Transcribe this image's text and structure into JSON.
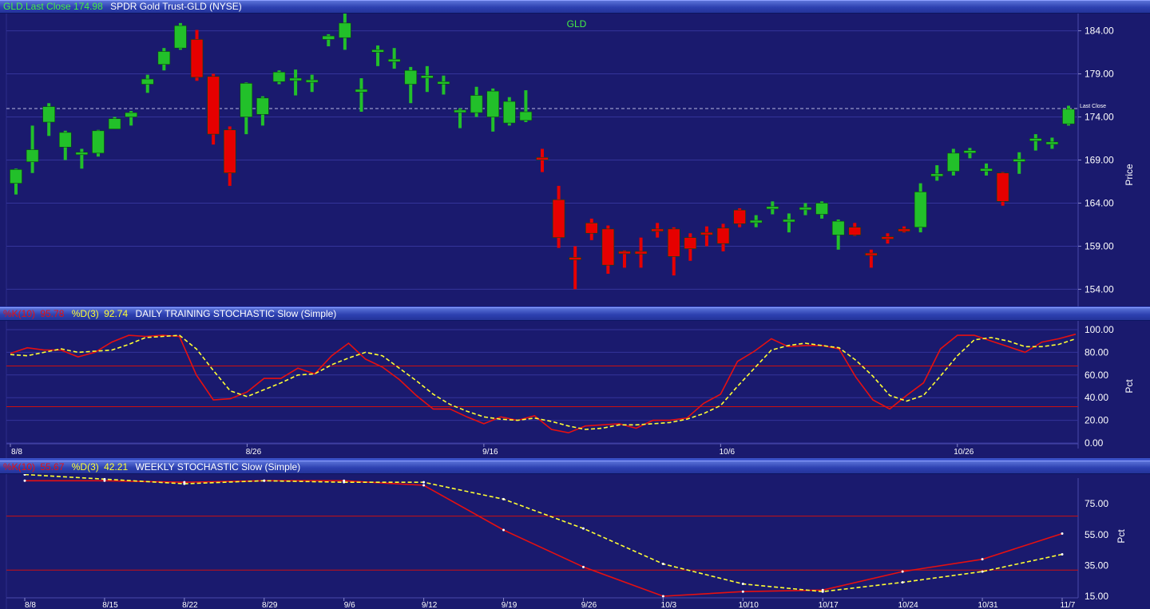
{
  "header": {
    "symbol_label": "GLD.Last Close",
    "last_close": "174.98",
    "description": "SPDR Gold Trust-GLD (NYSE)"
  },
  "daily_header": {
    "k_label": "%K(10)",
    "k_value": "95.78",
    "d_label": "%D(3)",
    "d_value": "92.74",
    "title": "DAILY TRAINING STOCHASTIC Slow (Simple)"
  },
  "weekly_header": {
    "k_label": "%K(10)",
    "k_value": "55.67",
    "d_label": "%D(3)",
    "d_value": "42.21",
    "title": "WEEKLY STOCHASTIC Slow (Simple)"
  },
  "colors": {
    "background": "#1a1a6e",
    "up": "#22c02a",
    "down": "#e60000",
    "k_line": "#e61010",
    "d_line": "#ffff33",
    "grid": "#34349a",
    "threshold": "#cc1010",
    "label_green": "#44ee44"
  },
  "chart_data": [
    {
      "type": "candlestick",
      "title": "GLD",
      "ylabel": "Price",
      "ylim": [
        152,
        186
      ],
      "yticks": [
        "184.00",
        "179.00",
        "174.00",
        "169.00",
        "164.00",
        "159.00",
        "154.00"
      ],
      "last_close_label": "Last Close",
      "last_close": 174.98,
      "candles": [
        {
          "o": 166.3,
          "c": 167.9,
          "h": 168.0,
          "l": 165.0
        },
        {
          "o": 168.8,
          "c": 170.2,
          "h": 173.0,
          "l": 167.5
        },
        {
          "o": 173.4,
          "c": 175.2,
          "h": 175.6,
          "l": 171.8
        },
        {
          "o": 170.5,
          "c": 172.2,
          "h": 172.4,
          "l": 169.0
        },
        {
          "o": 169.8,
          "c": 169.9,
          "h": 170.3,
          "l": 168.0
        },
        {
          "o": 169.8,
          "c": 172.4,
          "h": 172.5,
          "l": 169.4
        },
        {
          "o": 172.6,
          "c": 173.8,
          "h": 174.0,
          "l": 172.6
        },
        {
          "o": 174.0,
          "c": 174.5,
          "h": 174.7,
          "l": 173.0
        },
        {
          "o": 177.8,
          "c": 178.4,
          "h": 178.9,
          "l": 176.8
        },
        {
          "o": 180.1,
          "c": 181.6,
          "h": 182.0,
          "l": 179.4
        },
        {
          "o": 182.0,
          "c": 184.6,
          "h": 184.9,
          "l": 181.8
        },
        {
          "o": 183.0,
          "c": 178.6,
          "h": 184.1,
          "l": 178.2
        },
        {
          "o": 178.7,
          "c": 172.0,
          "h": 179.0,
          "l": 170.8
        },
        {
          "o": 172.5,
          "c": 167.5,
          "h": 172.9,
          "l": 166.0
        },
        {
          "o": 174.0,
          "c": 177.9,
          "h": 178.0,
          "l": 172.0
        },
        {
          "o": 174.3,
          "c": 176.2,
          "h": 176.4,
          "l": 173.0
        },
        {
          "o": 178.1,
          "c": 179.2,
          "h": 179.4,
          "l": 177.8
        },
        {
          "o": 178.4,
          "c": 178.5,
          "h": 179.5,
          "l": 176.5
        },
        {
          "o": 178.2,
          "c": 178.3,
          "h": 178.9,
          "l": 176.9
        },
        {
          "o": 183.0,
          "c": 183.4,
          "h": 183.6,
          "l": 182.2
        },
        {
          "o": 183.2,
          "c": 184.9,
          "h": 186.0,
          "l": 181.8
        },
        {
          "o": 176.9,
          "c": 177.2,
          "h": 178.5,
          "l": 174.6
        },
        {
          "o": 181.6,
          "c": 181.8,
          "h": 182.3,
          "l": 179.9
        },
        {
          "o": 180.6,
          "c": 180.7,
          "h": 182.0,
          "l": 179.6
        },
        {
          "o": 177.8,
          "c": 179.4,
          "h": 179.8,
          "l": 175.6
        },
        {
          "o": 178.7,
          "c": 178.8,
          "h": 179.9,
          "l": 176.9
        },
        {
          "o": 178.0,
          "c": 178.1,
          "h": 178.8,
          "l": 176.6
        },
        {
          "o": 174.7,
          "c": 174.8,
          "h": 175.0,
          "l": 172.7
        },
        {
          "o": 174.5,
          "c": 176.5,
          "h": 177.5,
          "l": 174.0
        },
        {
          "o": 174.0,
          "c": 177.0,
          "h": 177.3,
          "l": 172.3
        },
        {
          "o": 173.3,
          "c": 175.8,
          "h": 176.3,
          "l": 173.0
        },
        {
          "o": 173.6,
          "c": 174.6,
          "h": 177.1,
          "l": 173.4
        },
        {
          "o": 169.3,
          "c": 169.1,
          "h": 170.3,
          "l": 167.6
        },
        {
          "o": 164.4,
          "c": 160.0,
          "h": 166.0,
          "l": 158.8
        },
        {
          "o": 157.7,
          "c": 157.6,
          "h": 159.0,
          "l": 154.0
        },
        {
          "o": 161.7,
          "c": 160.5,
          "h": 162.2,
          "l": 159.7
        },
        {
          "o": 161.0,
          "c": 156.8,
          "h": 161.4,
          "l": 155.8
        },
        {
          "o": 158.4,
          "c": 158.2,
          "h": 158.5,
          "l": 156.5
        },
        {
          "o": 158.4,
          "c": 158.1,
          "h": 160.0,
          "l": 156.5
        },
        {
          "o": 161.0,
          "c": 160.9,
          "h": 161.7,
          "l": 160.0
        },
        {
          "o": 161.0,
          "c": 157.8,
          "h": 161.2,
          "l": 155.6
        },
        {
          "o": 160.0,
          "c": 158.7,
          "h": 160.5,
          "l": 157.3
        },
        {
          "o": 160.6,
          "c": 160.5,
          "h": 161.3,
          "l": 159.0
        },
        {
          "o": 161.1,
          "c": 159.3,
          "h": 161.6,
          "l": 158.4
        },
        {
          "o": 163.2,
          "c": 161.6,
          "h": 163.4,
          "l": 161.2
        },
        {
          "o": 161.9,
          "c": 162.0,
          "h": 162.6,
          "l": 161.2
        },
        {
          "o": 163.5,
          "c": 163.6,
          "h": 164.2,
          "l": 162.7
        },
        {
          "o": 162.0,
          "c": 162.1,
          "h": 162.8,
          "l": 160.6
        },
        {
          "o": 163.4,
          "c": 163.5,
          "h": 164.0,
          "l": 162.6
        },
        {
          "o": 162.7,
          "c": 164.0,
          "h": 164.2,
          "l": 162.2
        },
        {
          "o": 160.3,
          "c": 161.9,
          "h": 162.1,
          "l": 158.6
        },
        {
          "o": 161.2,
          "c": 160.3,
          "h": 161.7,
          "l": 160.2
        },
        {
          "o": 158.2,
          "c": 158.1,
          "h": 158.6,
          "l": 156.5
        },
        {
          "o": 160.1,
          "c": 160.0,
          "h": 160.5,
          "l": 159.3
        },
        {
          "o": 161.0,
          "c": 160.9,
          "h": 161.3,
          "l": 160.6
        },
        {
          "o": 161.2,
          "c": 165.3,
          "h": 166.3,
          "l": 160.6
        },
        {
          "o": 167.3,
          "c": 167.4,
          "h": 168.4,
          "l": 166.6
        },
        {
          "o": 167.7,
          "c": 169.8,
          "h": 170.3,
          "l": 167.2
        },
        {
          "o": 170.0,
          "c": 170.1,
          "h": 170.4,
          "l": 169.2
        },
        {
          "o": 167.9,
          "c": 168.0,
          "h": 168.6,
          "l": 167.2
        },
        {
          "o": 167.5,
          "c": 164.2,
          "h": 167.6,
          "l": 163.7
        },
        {
          "o": 169.0,
          "c": 169.1,
          "h": 169.9,
          "l": 167.4
        },
        {
          "o": 171.4,
          "c": 171.5,
          "h": 172.0,
          "l": 170.1
        },
        {
          "o": 171.0,
          "c": 171.1,
          "h": 171.6,
          "l": 170.3
        },
        {
          "o": 173.2,
          "c": 174.9,
          "h": 175.3,
          "l": 173.0
        }
      ]
    },
    {
      "type": "line",
      "title": "DAILY TRAINING STOCHASTIC Slow (Simple)",
      "ylabel": "Pct",
      "ylim": [
        0,
        100
      ],
      "yticks": [
        "100.00",
        "80.00",
        "60.00",
        "40.00",
        "20.00",
        "0.00"
      ],
      "thresholds": [
        68,
        32
      ],
      "xticks": [
        {
          "i": 0,
          "label": "8/8"
        },
        {
          "i": 14,
          "label": "8/26"
        },
        {
          "i": 28,
          "label": "9/16"
        },
        {
          "i": 42,
          "label": "10/6"
        },
        {
          "i": 56,
          "label": "10/26"
        }
      ],
      "series": [
        {
          "name": "%K(10)",
          "values": [
            79,
            84,
            82,
            82,
            76,
            80,
            89,
            95,
            94,
            95,
            94,
            60,
            38,
            39,
            45,
            57,
            57,
            66,
            61,
            77,
            88,
            74,
            67,
            56,
            42,
            30,
            30,
            23,
            17,
            23,
            20,
            24,
            12,
            9,
            15,
            16,
            17,
            13,
            20,
            20,
            22,
            35,
            43,
            72,
            81,
            92,
            85,
            86,
            86,
            83,
            58,
            38,
            30,
            42,
            53,
            83,
            95,
            95,
            90,
            85,
            80,
            89,
            92,
            96
          ]
        },
        {
          "name": "%D(3)",
          "values": [
            78,
            77,
            80,
            83,
            80,
            81,
            82,
            87,
            93,
            94,
            95,
            83,
            64,
            46,
            41,
            47,
            53,
            60,
            61,
            69,
            75,
            80,
            77,
            66,
            55,
            43,
            34,
            28,
            23,
            21,
            20,
            22,
            19,
            15,
            12,
            13,
            16,
            16,
            17,
            18,
            21,
            26,
            33,
            50,
            66,
            82,
            86,
            88,
            86,
            84,
            73,
            59,
            42,
            37,
            42,
            59,
            77,
            91,
            93,
            90,
            85,
            85,
            87,
            92
          ]
        }
      ]
    },
    {
      "type": "line",
      "title": "WEEKLY STOCHASTIC Slow (Simple)",
      "ylabel": "Pct",
      "ylim": [
        15,
        96
      ],
      "yticks": [
        "75.00",
        "55.00",
        "35.00",
        "15.00"
      ],
      "thresholds": [
        67,
        32
      ],
      "categories": [
        "8/8",
        "8/15",
        "8/22",
        "8/29",
        "9/6",
        "9/12",
        "9/19",
        "9/26",
        "10/3",
        "10/10",
        "10/17",
        "10/24",
        "10/31",
        "11/7"
      ],
      "series": [
        {
          "name": "%K(10)",
          "values": [
            90,
            90,
            89,
            90,
            90,
            87,
            58,
            34,
            15,
            18,
            19,
            31,
            39,
            55.67
          ]
        },
        {
          "name": "%D(3)",
          "values": [
            94,
            91,
            88,
            90,
            89,
            89,
            78,
            59,
            36,
            23,
            18,
            24,
            31,
            42.21
          ]
        }
      ]
    }
  ]
}
